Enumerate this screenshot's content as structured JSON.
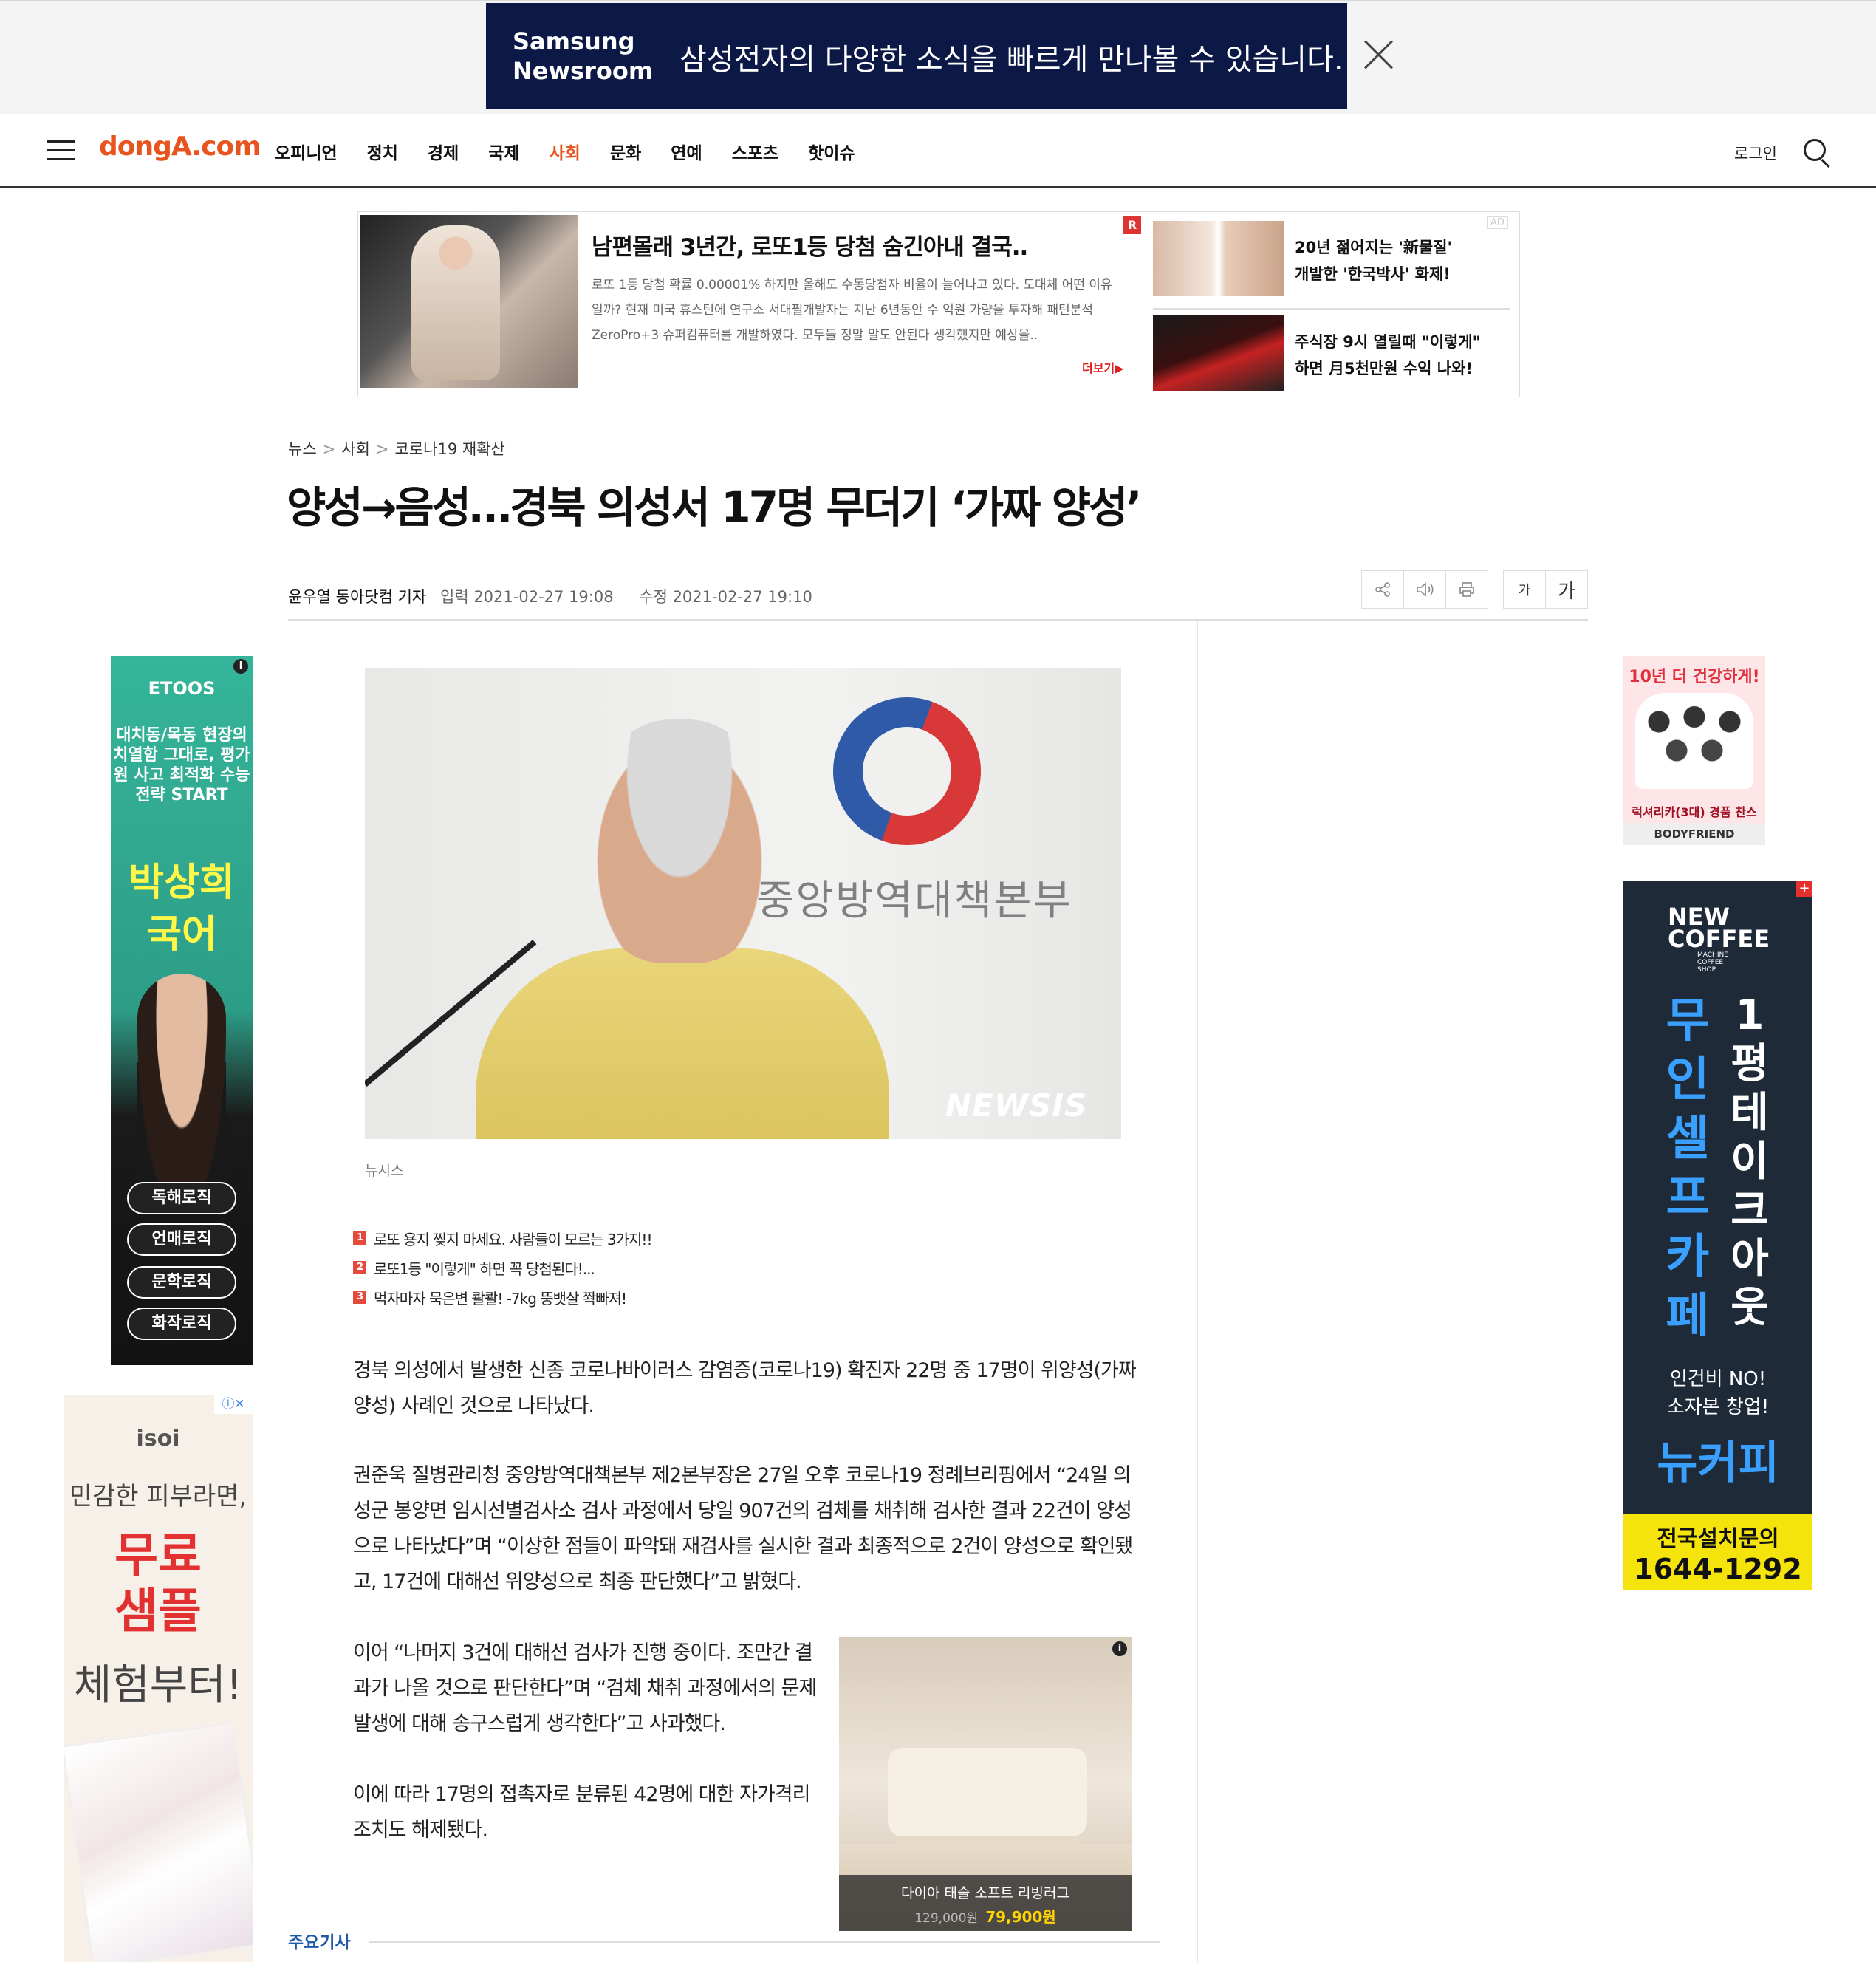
{
  "promo": {
    "brand_line1": "Samsung",
    "brand_line2": "Newsroom",
    "text": "삼성전자의 다양한 소식을 빠르게 만나볼 수 있습니다.",
    "bg_color": "#0c1946"
  },
  "nav": {
    "logo": "dongA.com",
    "items": [
      "오피니언",
      "정치",
      "경제",
      "국제",
      "사회",
      "문화",
      "연예",
      "스포츠",
      "핫이슈"
    ],
    "active": "사회",
    "login": "로그인",
    "accent_color": "#e8541e"
  },
  "top_ad": {
    "badge": "R",
    "ad_label": "AD",
    "title": "남편몰래 3년간, 로또1등 당첨 숨긴아내 결국..",
    "body": "로또 1등 당첨 확률 0.00001% 하지만 올해도 수동당첨자 비율이 늘어나고 있다. 도대체 어떤 이유일까? 현재 미국 휴스턴에 연구소 서대필개발자는 지난 6년동안 수 억원 가량을 투자해 패턴분석 ZeroPro+3 슈퍼컴퓨터를 개발하였다. 모두들 정말 말도 안된다 생각했지만 예상을..",
    "more": "더보기▶",
    "side_items": [
      {
        "line1": "20년 젊어지는 '新물질'",
        "line2": "개발한 '한국박사' 화제!"
      },
      {
        "line1": "주식장 9시 열릴때 \"이렇게\"",
        "line2": "하면 月5천만원 수익 나와!"
      }
    ]
  },
  "article": {
    "breadcrumb": [
      "뉴스",
      "사회",
      "코로나19 재확산"
    ],
    "headline": "양성→음성…경북 의성서 17명 무더기 ‘가짜 양성’",
    "byline": "윤우열 동아닷컴 기자",
    "published": "입력 2021-02-27 19:08",
    "modified": "수정 2021-02-27 19:10",
    "tools": {
      "font_small": "가",
      "font_large": "가"
    },
    "photo": {
      "org_text": "중앙방역대책본부",
      "watermark": "NEWSIS"
    },
    "caption": "뉴시스",
    "related": [
      {
        "num": "1",
        "text": "로또 용지 찢지 마세요. 사람들이 모르는 3가지!!"
      },
      {
        "num": "2",
        "text": "로또1등 \"이렇게\" 하면 꼭 당첨된다!..."
      },
      {
        "num": "3",
        "text": "먹자마자 묵은변 콸콸! -7kg 뚱뱃살 쫙빠져!"
      }
    ],
    "paragraphs": [
      "경북 의성에서 발생한 신종 코로나바이러스 감염증(코로나19) 확진자 22명 중 17명이 위양성(가짜양성) 사례인 것으로 나타났다.",
      "권준욱 질병관리청 중앙방역대책본부 제2본부장은 27일 오후 코로나19 정례브리핑에서 “24일 의성군 봉양면 임시선별검사소 검사 과정에서 당일 907건의 검체를 채취해 검사한 결과 22건이 양성으로 나타났다”며 “이상한 점들이 파악돼 재검사를 실시한 결과 최종적으로 2건이 양성으로 확인됐고, 17건에 대해선 위양성으로 최종 판단했다”고 밝혔다.",
      "이어 “나머지 3건에 대해선 검사가 진행 중이다. 조만간 결과가 나올 것으로 판단한다”며 “검체 채취 과정에서의 문제 발생에 대해 송구스럽게 생각한다”고 사과했다.",
      "이에 따라 17명의 접촉자로 분류된 42명에 대한 자가격리 조치도 해제됐다."
    ],
    "section_label": "주요기사"
  },
  "side_ads": {
    "etoos": {
      "brand": "ETOOS",
      "copy": "대치동/목동 현장의 치열함 그대로, 평가원 사고 최적화 수능 전략 START",
      "name_line1": "박상희",
      "name_line2": "국어",
      "pills": [
        "독해로직",
        "언매로직",
        "문학로직",
        "화작로직"
      ]
    },
    "isoi": {
      "brand": "isoi",
      "line1": "민감한 피부라면,",
      "line2a": "무료",
      "line2b": "샘플",
      "line3": "체험부터!",
      "close": "ⓘ✕"
    },
    "bodyfriend": {
      "title": "10년 더 건강하게!",
      "caption": "럭셔리카(3대) 경품 찬스",
      "brand": "BODYFRIEND"
    },
    "newcoffee": {
      "brand_line1": "NEW",
      "brand_line2": "COFFEE",
      "sub": "MACHINE COFFEE SHOP",
      "col1": [
        "무",
        "인",
        "셀",
        "프",
        "카",
        "페"
      ],
      "col2": [
        "1",
        "평",
        "테",
        "이",
        "크",
        "아",
        "웃"
      ],
      "line1": "인건비 NO!",
      "line2": "소자본 창업!",
      "logo": "뉴커피",
      "cta1": "전국설치문의",
      "cta2": "1644-1292",
      "plus": "+"
    },
    "rug": {
      "name": "다이아 태슬 소프트 리빙러그",
      "old_price": "129,000원",
      "new_price": "79,900원"
    }
  }
}
